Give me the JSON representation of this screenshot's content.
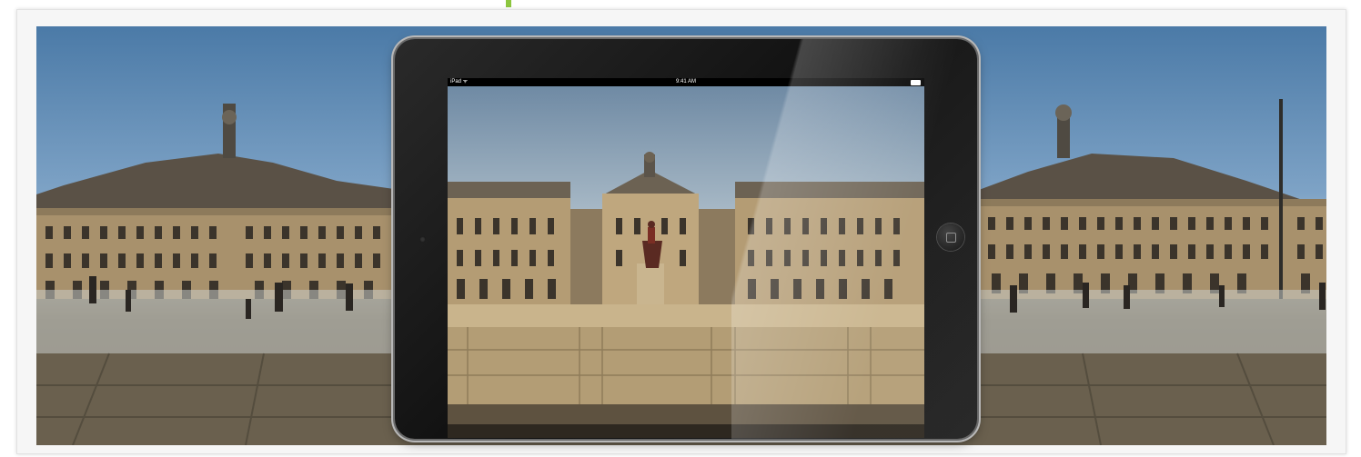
{
  "device": {
    "name": "iPad",
    "status_bar": {
      "carrier": "iPad ᯤ",
      "time": "9:41 AM"
    }
  },
  "colors": {
    "accent": "#8cc63f",
    "sky": "#4b7aa7",
    "building_stone": "#b49c74"
  }
}
